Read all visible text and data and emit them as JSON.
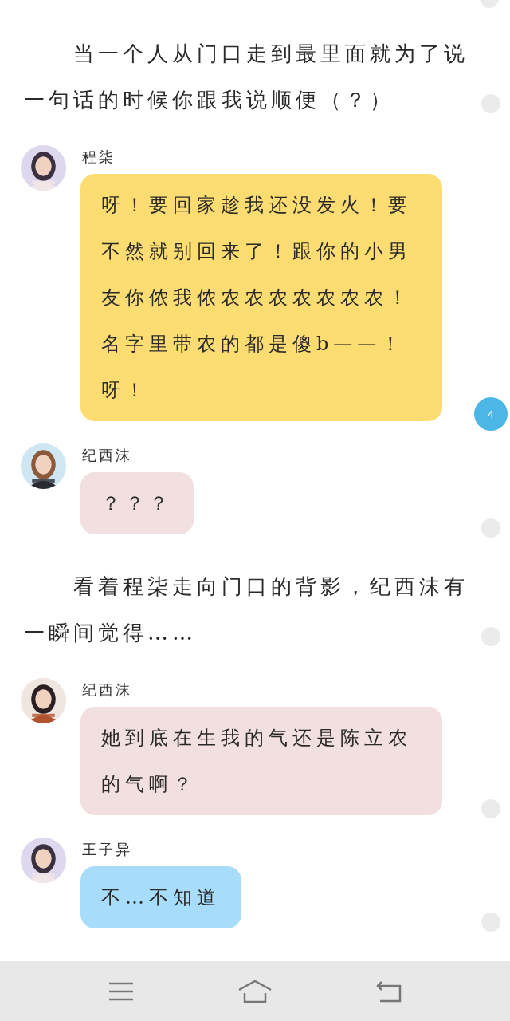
{
  "story": [
    {
      "kind": "narration",
      "text": "当一个人从门口走到最里面就为了说一句话的时候你跟我说顺便（？）"
    },
    {
      "kind": "message",
      "name": "程柒",
      "text": "呀！要回家趁我还没发火！要不然就别回来了！跟你的小男友你侬我侬农农农农农农农！名字里带农的都是傻b——！呀！",
      "color": "#fddc72",
      "comment_count": "4"
    },
    {
      "kind": "message",
      "name": "纪西沫",
      "text": "？？？",
      "color": "#f2dfe0"
    },
    {
      "kind": "narration",
      "text": "看着程柒走向门口的背影，纪西沫有一瞬间觉得……"
    },
    {
      "kind": "message",
      "name": "纪西沫",
      "text": "她到底在生我的气还是陈立农的气啊？",
      "color": "#f2dfe0"
    },
    {
      "kind": "message",
      "name": "王子异",
      "text": "不…不知道",
      "color": "#a7ddfb"
    }
  ]
}
